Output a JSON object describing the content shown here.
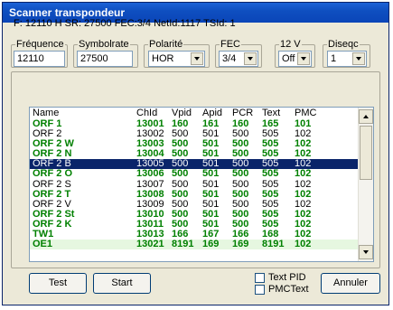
{
  "window": {
    "title": "Scanner transpondeur"
  },
  "info_line": "F: 12110 H SR: 27500 FEC:3/4 NetId:1117 TSId: 1",
  "fields": {
    "frequence": {
      "label": "Fréquence",
      "value": "12110"
    },
    "symbolrate": {
      "label": "Symbolrate",
      "value": "27500"
    },
    "polarite": {
      "label": "Polarité",
      "value": "HOR"
    },
    "fec": {
      "label": "FEC",
      "value": "3/4"
    },
    "v12": {
      "label": "12 V",
      "value": "Off"
    },
    "diseqc": {
      "label": "Diseqc",
      "value": "1"
    }
  },
  "table": {
    "headers": [
      "Name",
      "ChId",
      "Vpid",
      "Apid",
      "PCR",
      "Text",
      "PMC"
    ],
    "rows": [
      {
        "name": "ORF 1",
        "chid": "13001",
        "vpid": "160",
        "apid": "161",
        "pcr": "160",
        "text": "165",
        "pmc": "101",
        "style": "g"
      },
      {
        "name": "ORF 2",
        "chid": "13002",
        "vpid": "500",
        "apid": "501",
        "pcr": "500",
        "text": "505",
        "pmc": "102",
        "style": ""
      },
      {
        "name": "ORF 2 W",
        "chid": "13003",
        "vpid": "500",
        "apid": "501",
        "pcr": "500",
        "text": "505",
        "pmc": "102",
        "style": "g"
      },
      {
        "name": "ORF 2 N",
        "chid": "13004",
        "vpid": "500",
        "apid": "501",
        "pcr": "500",
        "text": "505",
        "pmc": "102",
        "style": "g"
      },
      {
        "name": "ORF 2 B",
        "chid": "13005",
        "vpid": "500",
        "apid": "501",
        "pcr": "500",
        "text": "505",
        "pmc": "102",
        "style": "sel"
      },
      {
        "name": "ORF 2 O",
        "chid": "13006",
        "vpid": "500",
        "apid": "501",
        "pcr": "500",
        "text": "505",
        "pmc": "102",
        "style": "g"
      },
      {
        "name": "ORF 2 S",
        "chid": "13007",
        "vpid": "500",
        "apid": "501",
        "pcr": "500",
        "text": "505",
        "pmc": "102",
        "style": ""
      },
      {
        "name": "ORF 2 T",
        "chid": "13008",
        "vpid": "500",
        "apid": "501",
        "pcr": "500",
        "text": "505",
        "pmc": "102",
        "style": "g"
      },
      {
        "name": "ORF 2 V",
        "chid": "13009",
        "vpid": "500",
        "apid": "501",
        "pcr": "500",
        "text": "505",
        "pmc": "102",
        "style": ""
      },
      {
        "name": "ORF 2 St",
        "chid": "13010",
        "vpid": "500",
        "apid": "501",
        "pcr": "500",
        "text": "505",
        "pmc": "102",
        "style": "g"
      },
      {
        "name": "ORF 2 K",
        "chid": "13011",
        "vpid": "500",
        "apid": "501",
        "pcr": "500",
        "text": "505",
        "pmc": "102",
        "style": "g"
      },
      {
        "name": "TW1",
        "chid": "13013",
        "vpid": "166",
        "apid": "167",
        "pcr": "166",
        "text": "168",
        "pmc": "102",
        "style": "g"
      },
      {
        "name": "OE1",
        "chid": "13021",
        "vpid": "8191",
        "apid": "169",
        "pcr": "169",
        "text": "8191",
        "pmc": "102",
        "style": "g hi"
      }
    ]
  },
  "buttons": {
    "test": "Test",
    "start": "Start",
    "annuler": "Annuler"
  },
  "checkboxes": {
    "text_pid": "Text PID",
    "pmc_text": "PMCText"
  },
  "colors": {
    "titlebar": "#0a45b8",
    "green_text": "#008000",
    "selection": "#0a246a"
  }
}
